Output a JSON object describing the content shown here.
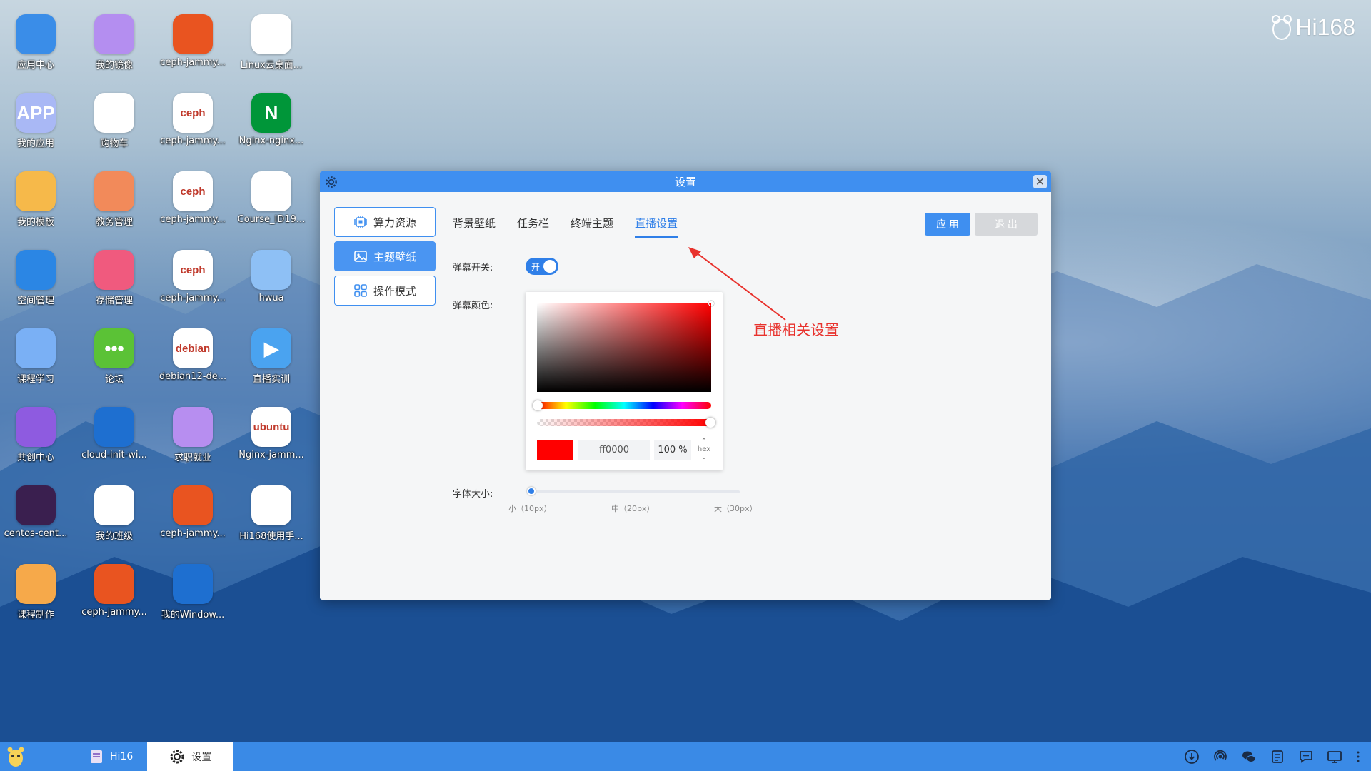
{
  "brand": {
    "text": "Hi168"
  },
  "desktop_icons": [
    {
      "label": "应用中心",
      "icon": "app-center-icon",
      "color": "#3a8de8"
    },
    {
      "label": "我的镜像",
      "icon": "image-icon",
      "color": "#b48ef0"
    },
    {
      "label": "ceph-jammy...",
      "icon": "ubuntu-icon",
      "color": "#e95420"
    },
    {
      "label": "Linux云桌面...",
      "icon": "linux-penguin-icon",
      "color": "#ffffff"
    },
    {
      "label": "我的应用",
      "icon": "app-icon",
      "color": "#a9b8f5",
      "glyph": "APP"
    },
    {
      "label": "购物车",
      "icon": "cart-icon",
      "color": "#ffffff"
    },
    {
      "label": "ceph-jammy...",
      "icon": "ceph-icon",
      "color": "#ffffff",
      "glyph": "ceph"
    },
    {
      "label": "Nginx-nginx...",
      "icon": "nginx-icon",
      "color": "#009639",
      "glyph": "N"
    },
    {
      "label": "我的模板",
      "icon": "folder-icon",
      "color": "#f6b94a"
    },
    {
      "label": "教务管理",
      "icon": "book-icon",
      "color": "#f28a5a"
    },
    {
      "label": "ceph-jammy...",
      "icon": "ceph-icon",
      "color": "#ffffff",
      "glyph": "ceph"
    },
    {
      "label": "Course_ID19...",
      "icon": "linux-penguin-icon",
      "color": "#ffffff"
    },
    {
      "label": "空间管理",
      "icon": "space-icon",
      "color": "#2b86e4"
    },
    {
      "label": "存储管理",
      "icon": "storage-icon",
      "color": "#f05a7e"
    },
    {
      "label": "ceph-jammy...",
      "icon": "ceph-icon",
      "color": "#ffffff",
      "glyph": "ceph"
    },
    {
      "label": "hwua",
      "icon": "hwua-icon",
      "color": "#8ec0f5"
    },
    {
      "label": "课程学习",
      "icon": "course-icon",
      "color": "#7ab0f5"
    },
    {
      "label": "论坛",
      "icon": "forum-icon",
      "color": "#5bc236",
      "glyph": "•••"
    },
    {
      "label": "debian12-de...",
      "icon": "debian-icon",
      "color": "#ffffff",
      "glyph": "debian"
    },
    {
      "label": "直播实训",
      "icon": "live-icon",
      "color": "#4aa3f0",
      "glyph": "▶"
    },
    {
      "label": "共创中心",
      "icon": "cocreate-icon",
      "color": "#8e5be0"
    },
    {
      "label": "cloud-init-wi...",
      "icon": "windows-icon",
      "color": "#1e6fd0"
    },
    {
      "label": "求职就业",
      "icon": "job-icon",
      "color": "#b78ef0"
    },
    {
      "label": "Nginx-jamm...",
      "icon": "ubuntu-icon",
      "color": "#ffffff",
      "glyph": "ubuntu"
    },
    {
      "label": "centos-cent...",
      "icon": "centos-icon",
      "color": "#3a1f4f"
    },
    {
      "label": "我的班级",
      "icon": "class-icon",
      "color": "#ffffff"
    },
    {
      "label": "ceph-jammy...",
      "icon": "ubuntu-icon",
      "color": "#e95420"
    },
    {
      "label": "Hi168使用手...",
      "icon": "manual-icon",
      "color": "#ffffff"
    },
    {
      "label": "课程制作",
      "icon": "course-make-icon",
      "color": "#f6a94a"
    },
    {
      "label": "ceph-jammy...",
      "icon": "ubuntu-icon",
      "color": "#e95420"
    },
    {
      "label": "我的Window...",
      "icon": "windows-icon",
      "color": "#1e6fd0"
    }
  ],
  "window": {
    "title": "设置",
    "side": [
      "算力资源",
      "主题壁纸",
      "操作模式"
    ],
    "tabs": [
      "背景壁纸",
      "任务栏",
      "终端主题",
      "直播设置"
    ],
    "active_tab": "直播设置",
    "apply": "应 用",
    "exit": "退 出",
    "danmu_switch_label": "弹幕开关:",
    "danmu_switch_text": "开",
    "danmu_color_label": "弹幕颜色:",
    "color_hex": "ff0000",
    "color_alpha": "100 %",
    "color_mode": "hex",
    "accent_color": "#ff0000",
    "font_size_label": "字体大小:",
    "font_ticks": [
      "小（10px）",
      "中（20px）",
      "大（30px）"
    ]
  },
  "annotation": "直播相关设置",
  "taskbar": {
    "items": [
      {
        "label": "Hi16",
        "icon": "manual-icon"
      },
      {
        "label": "设置",
        "icon": "gear-icon"
      }
    ]
  }
}
